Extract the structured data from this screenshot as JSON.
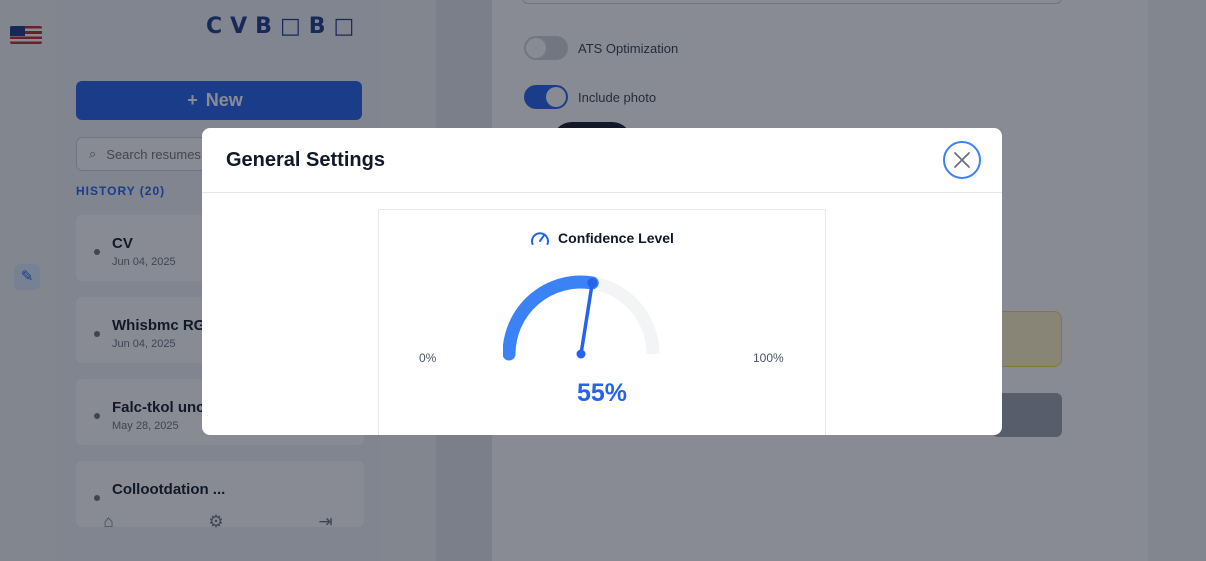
{
  "background": {
    "logo_text": "CVB□B□",
    "new_button_label": "New",
    "search_placeholder": "Search resumes",
    "history_label": "HISTORY (20)",
    "history_items": [
      {
        "title": "CV",
        "date": "Jun 04, 2025"
      },
      {
        "title": "Whisbmc RG",
        "date": "Jun 04, 2025"
      },
      {
        "title": "Falc-tkol unc",
        "date": "May 28, 2025"
      },
      {
        "title": "Collootdation ...",
        "date": ""
      }
    ],
    "toggles": [
      {
        "label": "ATS Optimization",
        "on": false
      },
      {
        "label": "Include photo",
        "on": true
      }
    ]
  },
  "modal": {
    "title": "General Settings",
    "gauge": {
      "label": "Confidence Level",
      "min_label": "0%",
      "max_label": "100%",
      "value": 55,
      "value_text": "55%",
      "fill_color": "#3b82f6",
      "track_color": "#f3f4f6",
      "needle_color": "#2563eb"
    }
  },
  "icons": {
    "close": "close-icon",
    "gauge": "gauge-icon",
    "search": "search-icon",
    "plus": "plus-icon"
  }
}
